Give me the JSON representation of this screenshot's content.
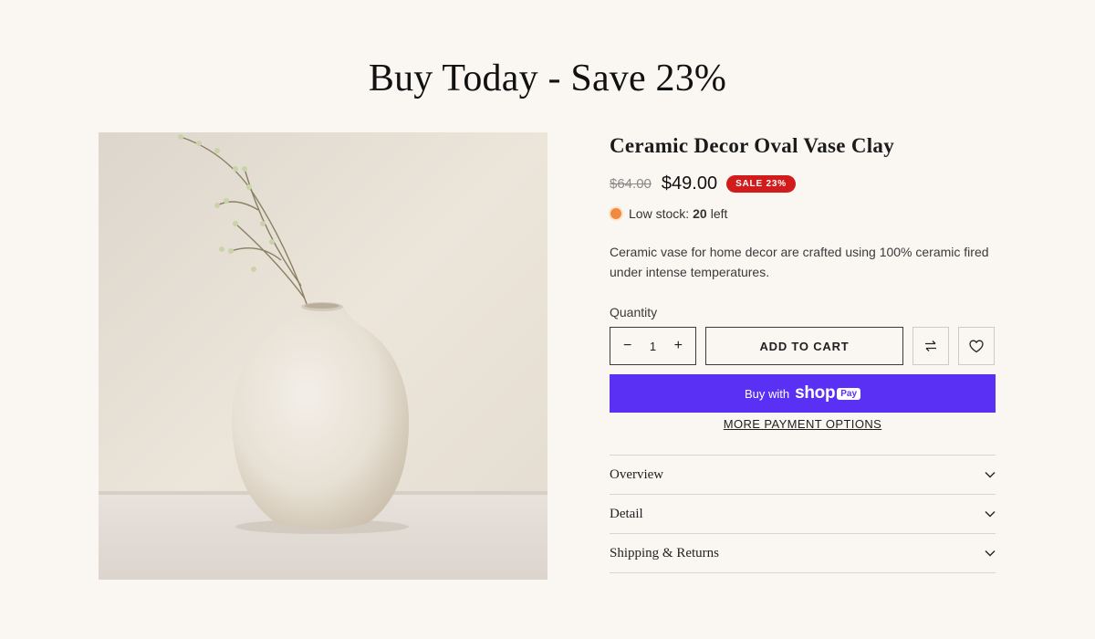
{
  "heading": "Buy Today - Save 23%",
  "product": {
    "title": "Ceramic Decor Oval Vase Clay",
    "old_price": "$64.00",
    "price": "$49.00",
    "sale_badge": "SALE 23%",
    "stock_label": "Low stock:",
    "stock_count": "20",
    "stock_suffix": "left",
    "description": "Ceramic vase for home decor are crafted using 100% ceramic fired under intense temperatures."
  },
  "quantity": {
    "label": "Quantity",
    "value": "1",
    "minus": "−",
    "plus": "+"
  },
  "buttons": {
    "add_to_cart": "ADD TO CART",
    "buy_with": "Buy with",
    "shop_brand": "shop",
    "pay_badge": "Pay",
    "more_payment": "MORE PAYMENT OPTIONS"
  },
  "accordion": [
    {
      "label": "Overview"
    },
    {
      "label": "Detail"
    },
    {
      "label": "Shipping & Returns"
    }
  ],
  "colors": {
    "background": "#faf7f3",
    "sale_badge": "#d21c1c",
    "shop_pay": "#5a31f4",
    "stock_dot": "#f08a3c"
  },
  "icons": [
    "compare-icon",
    "heart-icon",
    "chevron-down-icon",
    "stock-status-dot"
  ]
}
